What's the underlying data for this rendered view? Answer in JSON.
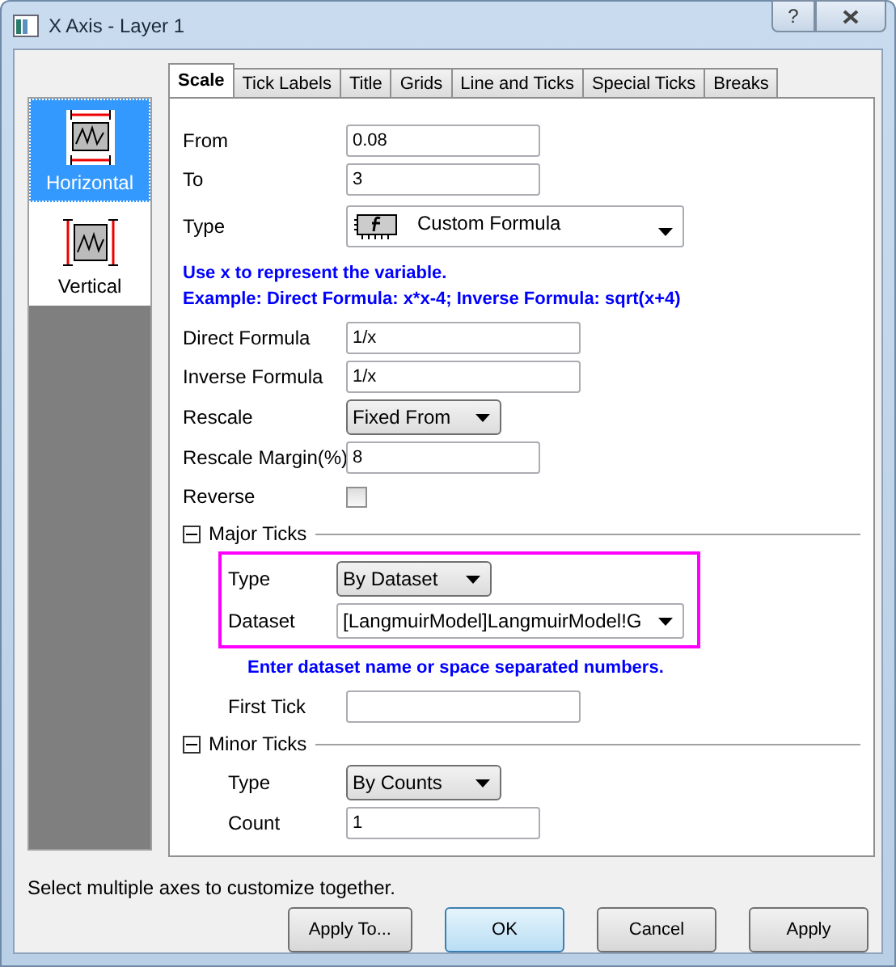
{
  "window": {
    "title": "X Axis - Layer 1",
    "help": "?"
  },
  "sidebar": {
    "items": [
      {
        "label": "Horizontal",
        "kind": "horizontal",
        "selected": true
      },
      {
        "label": "Vertical",
        "kind": "vertical",
        "selected": false
      }
    ]
  },
  "tabs": [
    {
      "label": "Scale",
      "selected": true
    },
    {
      "label": "Tick Labels",
      "selected": false
    },
    {
      "label": "Title",
      "selected": false
    },
    {
      "label": "Grids",
      "selected": false
    },
    {
      "label": "Line and Ticks",
      "selected": false
    },
    {
      "label": "Special Ticks",
      "selected": false
    },
    {
      "label": "Breaks",
      "selected": false
    }
  ],
  "rows": [
    {
      "kind": "number",
      "label": "From",
      "value": "0.08"
    },
    {
      "kind": "number",
      "label": "To",
      "value": "3"
    },
    {
      "kind": "type_combo",
      "label": "Type",
      "value": "Custom Formula"
    },
    {
      "kind": "note",
      "lines": [
        "Use x to represent the variable.",
        "Example: Direct Formula: x*x-4; Inverse Formula: sqrt(x+4)"
      ]
    },
    {
      "kind": "formula",
      "label": "Direct Formula",
      "value": "1/x"
    },
    {
      "kind": "formula",
      "label": "Inverse Formula",
      "value": "1/x"
    },
    {
      "kind": "combo",
      "label": "Rescale",
      "value": "Fixed From"
    },
    {
      "kind": "number",
      "label": "Rescale Margin(%)",
      "value": "8"
    },
    {
      "kind": "checkbox",
      "label": "Reverse",
      "checked": false
    },
    {
      "kind": "section",
      "title": "Major Ticks",
      "expanded": true,
      "children": [
        {
          "kind": "group",
          "highlighted": true,
          "children": [
            {
              "kind": "combo",
              "label": "Type",
              "value": "By Dataset"
            },
            {
              "kind": "dataset_combo",
              "label": "Dataset",
              "value": "[LangmuirModel]LangmuirModel!G"
            }
          ]
        },
        {
          "kind": "note",
          "lines": [
            "Enter dataset name or space separated numbers."
          ]
        },
        {
          "kind": "formula",
          "label": "First Tick"
        }
      ]
    },
    {
      "kind": "section",
      "title": "Minor Ticks",
      "expanded": true,
      "children": [
        {
          "kind": "combo",
          "label": "Type",
          "value": "By Counts"
        },
        {
          "kind": "number",
          "label": "Count",
          "value": "1"
        }
      ]
    }
  ],
  "status": "Select multiple axes to customize together.",
  "buttons": [
    {
      "label": "Apply To...",
      "default": false
    },
    {
      "label": "OK",
      "default": true
    },
    {
      "label": "Cancel",
      "default": false
    },
    {
      "label": "Apply",
      "default": false
    }
  ]
}
